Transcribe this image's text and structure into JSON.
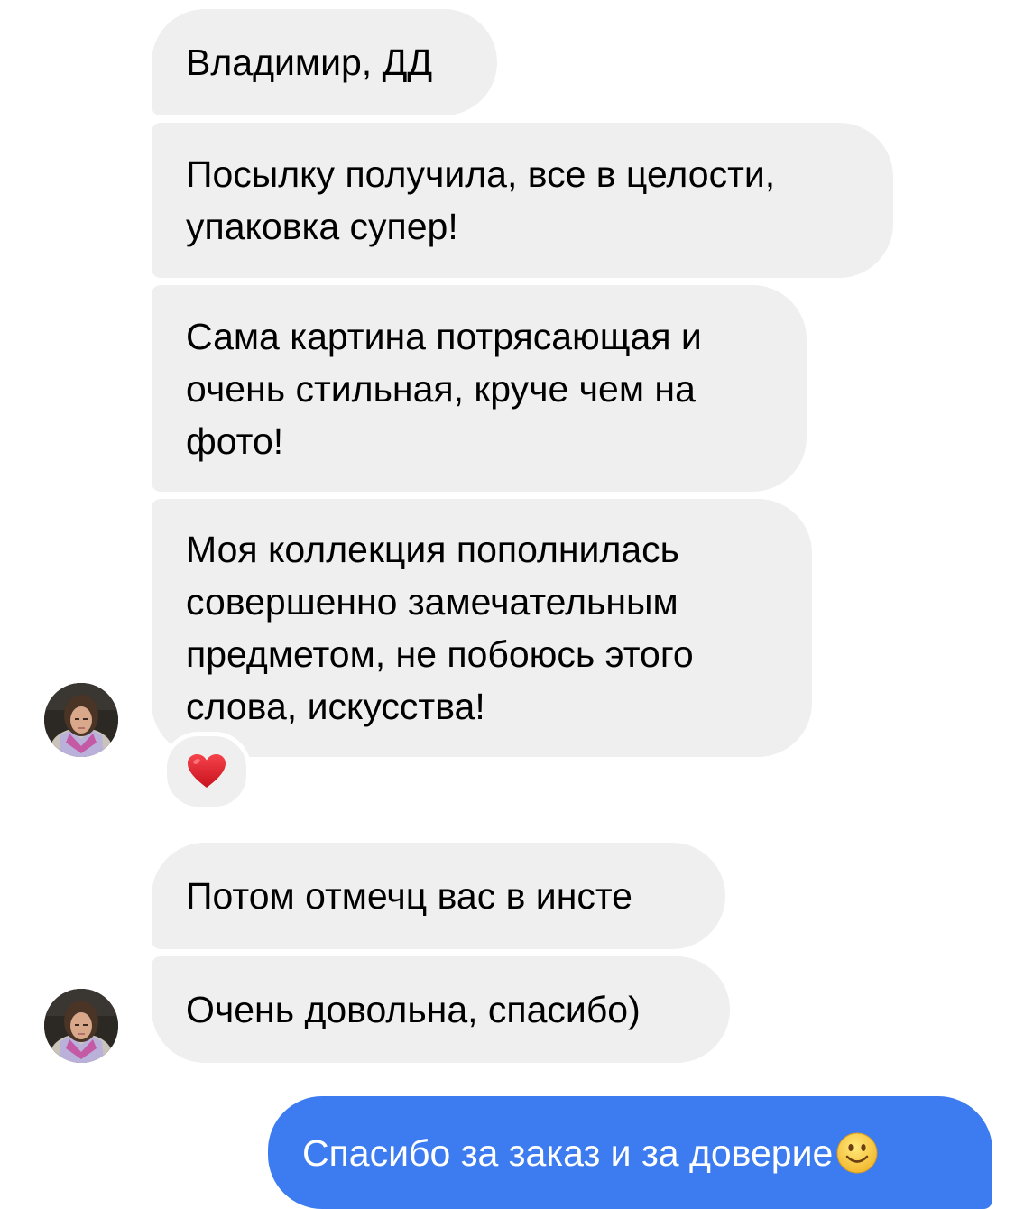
{
  "conversation": {
    "incoming": [
      {
        "lines": [
          "Владимир, ДД"
        ]
      },
      {
        "lines": [
          "Посылку получила, все в целости,",
          "упаковка супер!"
        ]
      },
      {
        "lines": [
          "Сама картина потрясающая и",
          "очень стильная, круче чем на",
          "фото!"
        ]
      },
      {
        "lines": [
          "Моя коллекция пополнилась",
          "совершенно замечательным",
          "предметом, не побоюсь этого",
          "слова, искусства!"
        ],
        "reaction": "❤️"
      },
      {
        "lines": [
          "Потом отмечц вас в инсте"
        ]
      },
      {
        "lines": [
          "Очень довольна, спасибо)"
        ]
      }
    ],
    "outgoing": [
      {
        "text": "Спасибо за заказ и за доверие",
        "emoji": "smile-emoji-icon"
      }
    ]
  },
  "colors": {
    "incoming_bubble": "#efefef",
    "outgoing_bubble": "#3d7cf0",
    "heart": "#e0242d"
  }
}
